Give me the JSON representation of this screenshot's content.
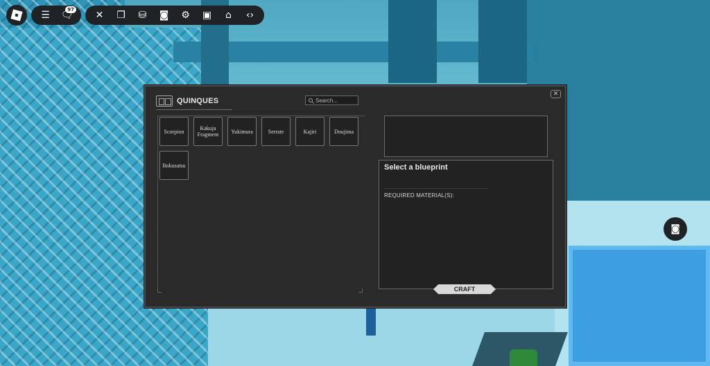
{
  "topbar": {
    "logo_icon": "roblox-logo-icon",
    "menu_icon": "hamburger-menu-icon",
    "chat_icon": "chat-icon",
    "chat_badge": "97",
    "tools": [
      {
        "name": "close-icon",
        "glyph": "✕"
      },
      {
        "name": "inventory-icon",
        "glyph": "❐"
      },
      {
        "name": "shop-basket-icon",
        "glyph": "⛁"
      },
      {
        "name": "camera-icon",
        "glyph": "◙"
      },
      {
        "name": "gear-icon",
        "glyph": "⚙"
      },
      {
        "name": "backpack-icon",
        "glyph": "▣"
      },
      {
        "name": "home-icon",
        "glyph": "⌂"
      },
      {
        "name": "code-icon",
        "glyph": "‹›"
      }
    ]
  },
  "side": {
    "screenshot_icon": "screenshot-camera-icon"
  },
  "panel": {
    "title": "QUINQUES",
    "close_glyph": "✕",
    "search_placeholder": "Search...",
    "items": [
      "Scorpion",
      "Kakuja Fragment",
      "Yukimura",
      "Serrate",
      "Kajiri",
      "Doujima",
      "Bokusatsu"
    ],
    "details_title": "Select a blueprint",
    "required_label": "REQUIRED MATERIAL(S):",
    "craft_label": "CRAFT"
  },
  "colors": {
    "panel_bg": "#2a2a2a",
    "slot_bg": "#222222",
    "craft_bg": "#d9d9d9"
  }
}
